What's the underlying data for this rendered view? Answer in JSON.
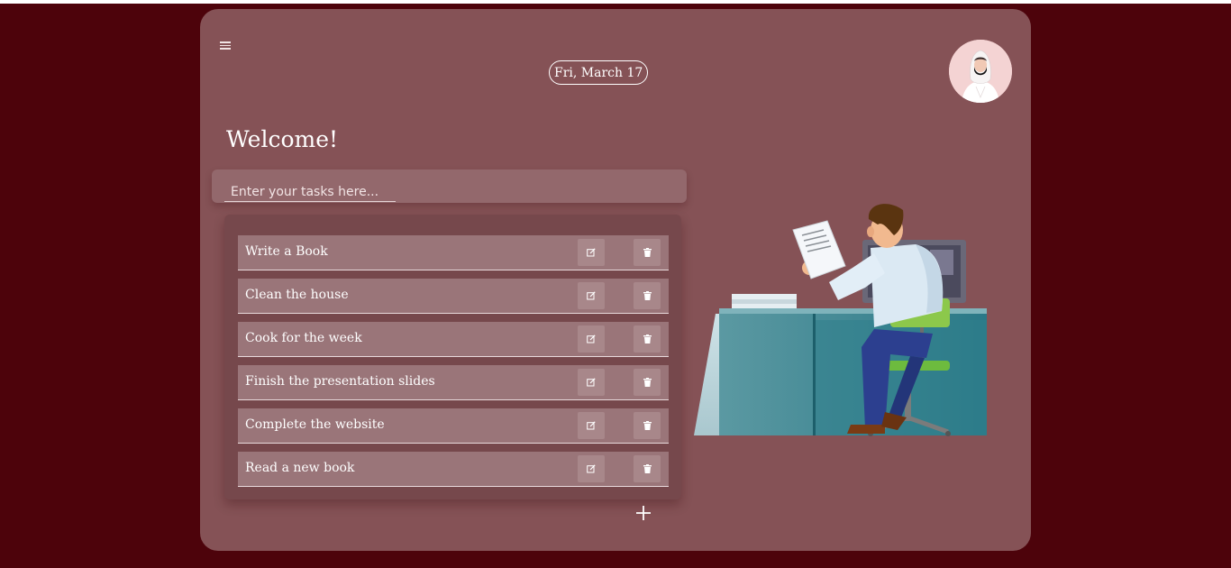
{
  "header": {
    "menu_icon": "hamburger-menu-icon",
    "date": "Fri, March 17",
    "avatar_icon": "user-avatar"
  },
  "main": {
    "welcome": "Welcome!",
    "input_placeholder": "Enter your tasks here...",
    "tasks": [
      {
        "text": "Write a Book"
      },
      {
        "text": "Clean the house"
      },
      {
        "text": "Cook for the week"
      },
      {
        "text": "Finish the presentation slides"
      },
      {
        "text": "Complete the website"
      },
      {
        "text": "Read a new book"
      }
    ],
    "task_icons": {
      "edit": "edit-icon",
      "delete": "trash-icon"
    },
    "add_icon": "plus-icon"
  },
  "colors": {
    "page_background": "#4d030b",
    "card_background": "#855256",
    "panel_background": "#76484c",
    "row_background": "#9a7579"
  }
}
